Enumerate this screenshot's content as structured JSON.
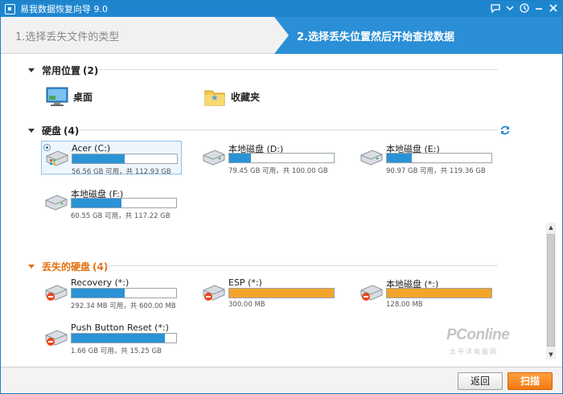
{
  "window": {
    "title": "易我数据恢复向导 9.0"
  },
  "steps": {
    "step1": "1.选择丢失文件的类型",
    "step2": "2.选择丢失位置然后开始查找数据"
  },
  "common": {
    "heading": "常用位置",
    "count": "(2)",
    "items": [
      {
        "label": "桌面",
        "icon": "desktop-icon"
      },
      {
        "label": "收藏夹",
        "icon": "favorites-folder-icon"
      }
    ]
  },
  "disks": {
    "heading": "硬盘",
    "count": "(4)",
    "items": [
      {
        "name": "Acer (C:)",
        "size": "56.56 GB 可用，共 112.93 GB",
        "used_pct": 50,
        "selected": true
      },
      {
        "name": "本地磁盘 (D:)",
        "size": "79.45 GB 可用，共 100.00 GB",
        "used_pct": 21
      },
      {
        "name": "本地磁盘 (E:)",
        "size": "90.97 GB 可用，共 119.36 GB",
        "used_pct": 24
      },
      {
        "name": "本地磁盘 (F:)",
        "size": "60.55 GB 可用，共 117.22 GB",
        "used_pct": 48
      }
    ]
  },
  "lost": {
    "heading": "丢失的硬盘",
    "count": "(4)",
    "items": [
      {
        "name": "Recovery (*:)",
        "size": "292.34 MB 可用，共 600.00 MB",
        "used_pct": 51,
        "color": "blue"
      },
      {
        "name": "ESP (*:)",
        "size": "300.00 MB",
        "used_pct": 100,
        "color": "orange"
      },
      {
        "name": "本地磁盘 (*:)",
        "size": "128.00 MB",
        "used_pct": 100,
        "color": "orange"
      },
      {
        "name": "Push Button Reset (*:)",
        "size": "1.66 GB 可用，共 15.25 GB",
        "used_pct": 89,
        "color": "blue"
      }
    ]
  },
  "footer": {
    "back": "返回",
    "scan": "扫描"
  },
  "watermark": {
    "text": "PConline",
    "sub": "太平洋电脑网"
  },
  "colors": {
    "accent": "#2a8fd6",
    "orange": "#e36f12",
    "bar_blue": "#2a93d6",
    "bar_orange": "#f4a42a"
  }
}
